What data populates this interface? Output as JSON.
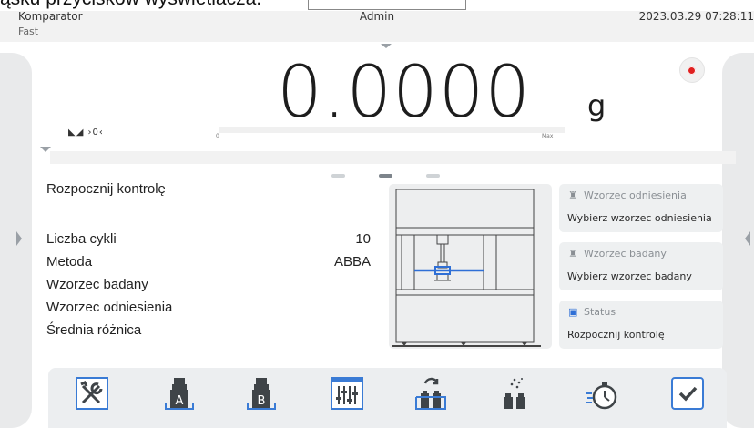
{
  "doc_overlay_text": "ąsku przycisków wyświetlacza.",
  "header": {
    "mode": "Komparator",
    "submode": "Fast",
    "user": "Admin",
    "datetime": "2023.03.29 07:28:11"
  },
  "weighing": {
    "value": "0.0000",
    "unit": "g",
    "indicators": "◣◢ ›0‹",
    "bar_min": "0",
    "bar_max": "Max"
  },
  "pager": {
    "pages": 3,
    "active_index": 1
  },
  "panel": {
    "title": "Rozpocznij kontrolę",
    "params": [
      {
        "label": "Liczba cykli",
        "value": "10"
      },
      {
        "label": "Metoda",
        "value": "ABBA"
      },
      {
        "label": "Wzorzec badany",
        "value": ""
      },
      {
        "label": "Wzorzec odniesienia",
        "value": ""
      },
      {
        "label": "Średnia różnica",
        "value": ""
      }
    ]
  },
  "cards": [
    {
      "icon": "weight-icon",
      "title": "Wzorzec odniesienia",
      "value": "Wybierz wzorzec odniesienia"
    },
    {
      "icon": "weight-icon",
      "title": "Wzorzec badany",
      "value": "Wybierz wzorzec badany"
    },
    {
      "icon": "status-icon",
      "title": "Status",
      "value": "Rozpocznij kontrolę"
    }
  ],
  "toolbar": [
    {
      "name": "settings-tools-button",
      "icon": "tools-icon"
    },
    {
      "name": "weight-a-button",
      "icon": "weight-a-icon",
      "letter": "A"
    },
    {
      "name": "weight-b-button",
      "icon": "weight-b-icon",
      "letter": "B"
    },
    {
      "name": "parameters-button",
      "icon": "sliders-icon"
    },
    {
      "name": "swap-weights-button",
      "icon": "swap-weights-icon"
    },
    {
      "name": "auto-weights-button",
      "icon": "sparkle-weights-icon"
    },
    {
      "name": "timer-button",
      "icon": "stopwatch-icon"
    },
    {
      "name": "confirm-button",
      "icon": "check-icon"
    }
  ],
  "colors": {
    "accent_blue": "#2f6fd6",
    "icon_blue": "#3a7bd5",
    "icon_dark": "#3f4448",
    "panel_bg": "#eef0f1",
    "record_red": "#e02020"
  }
}
